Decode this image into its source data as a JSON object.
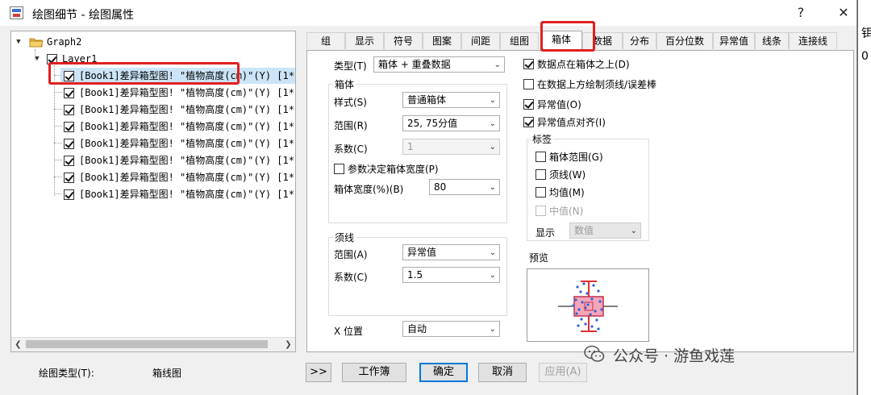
{
  "window": {
    "title": "绘图细节 - 绘图属性",
    "help_label": "?",
    "close_label": "✕"
  },
  "edge_text": {
    "top": "铒",
    "second": "0"
  },
  "tree": {
    "root": "Graph2",
    "layer": "Layer1",
    "items": [
      "[Book1]差异箱型图! \"植物高度(cm)\"(Y)  [1*",
      "[Book1]差异箱型图! \"植物高度(cm)\"(Y)  [1*",
      "[Book1]差异箱型图! \"植物高度(cm)\"(Y)  [1*",
      "[Book1]差异箱型图! \"植物高度(cm)\"(Y)  [1*",
      "[Book1]差异箱型图! \"植物高度(cm)\"(Y)  [1*",
      "[Book1]差异箱型图! \"植物高度(cm)\"(Y)  [1*",
      "[Book1]差异箱型图! \"植物高度(cm)\"(Y)  [1*",
      "[Book1]差异箱型图! \"植物高度(cm)\"(Y)  [1*"
    ]
  },
  "tabs": [
    "组",
    "显示",
    "符号",
    "图案",
    "间距",
    "组图",
    "箱体",
    "数据",
    "分布",
    "百分位数",
    "异常值",
    "线条",
    "连接线"
  ],
  "active_tab": "箱体",
  "form": {
    "type_label": "类型(T)",
    "type_value": "箱体 + 重叠数据",
    "box_group": "箱体",
    "style_label": "样式(S)",
    "style_value": "普通箱体",
    "range_label": "范围(R)",
    "range_value": "25, 75分值",
    "coef_label": "系数(C)",
    "coef_value": "1",
    "param_width_label": "参数决定箱体宽度(P)",
    "width_label": "箱体宽度(%)(B)",
    "width_value": "80",
    "whisker_group": "须线",
    "w_range_label": "范围(A)",
    "w_range_value": "异常值",
    "w_coef_label": "系数(C)",
    "w_coef_value": "1.5",
    "xpos_label": "X 位置",
    "xpos_value": "自动"
  },
  "right_options": {
    "above_box": "数据点在箱体之上(D)",
    "whisker_above": "在数据上方绘制须线/误差棒",
    "outliers": "异常值(O)",
    "align_outliers": "异常值点对齐(I)",
    "labels_group": "标签",
    "box_range": "箱体范围(G)",
    "whisker": "须线(W)",
    "mean": "均值(M)",
    "median": "中值(N)",
    "display_label": "显示",
    "display_value": "数值",
    "preview_label": "预览"
  },
  "checks": {
    "above_box": true,
    "whisker_above": false,
    "outliers": true,
    "align_outliers": true,
    "param_width": false,
    "box_range": false,
    "whisker": false,
    "mean": false,
    "median": false
  },
  "bottom": {
    "plot_type_label": "绘图类型(T):",
    "plot_type_value": "箱线图",
    "more_btn": ">>",
    "workbook_btn": "工作簿",
    "ok_btn": "确定",
    "cancel_btn": "取消",
    "apply_btn": "应用(A)"
  },
  "watermark": "公众号 · 游鱼戏莲",
  "colors": {
    "highlight": "#e02020",
    "accent": "#0078d7",
    "preview_box": "#f4a7b9",
    "preview_points": "#3060e0",
    "preview_whisker": "#e03030"
  }
}
